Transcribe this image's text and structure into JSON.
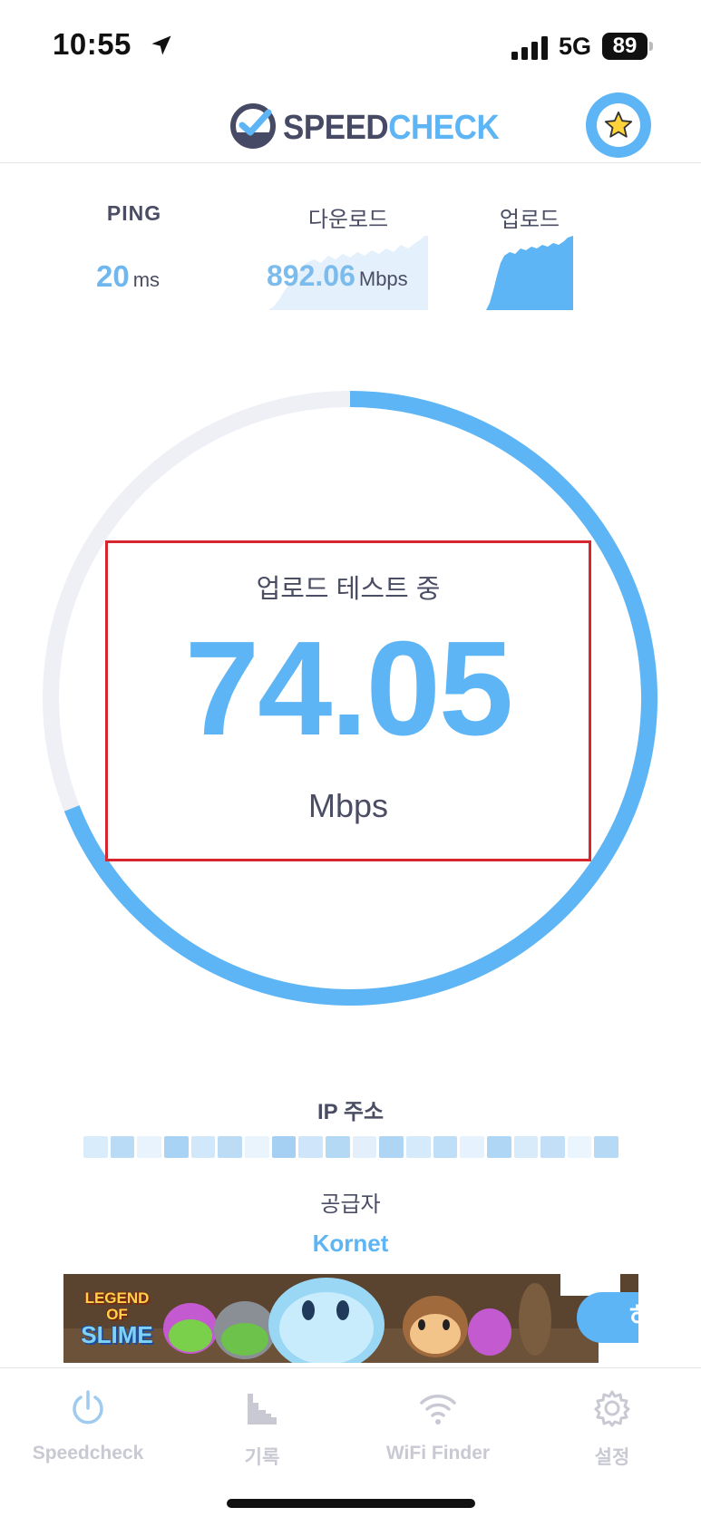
{
  "status_bar": {
    "time": "10:55",
    "network": "5G",
    "battery": "89"
  },
  "header": {
    "logo_part1": "SPEED",
    "logo_part2": "CHECK"
  },
  "metrics": {
    "ping": {
      "label": "PING",
      "value": "20",
      "unit": "ms"
    },
    "download": {
      "label": "다운로드",
      "value": "892.06",
      "unit": "Mbps"
    },
    "upload": {
      "label": "업로드"
    }
  },
  "gauge": {
    "status": "업로드 테스트 중",
    "value": "74.05",
    "unit": "Mbps",
    "progress": 0.69
  },
  "info": {
    "ip_label": "IP 주소",
    "provider_label": "공급자",
    "provider_value": "Kornet"
  },
  "ad": {
    "logo_line1": "LEGEND",
    "logo_line2": "OF",
    "logo_line3": "SLIME",
    "cta": "하다"
  },
  "tabs": [
    {
      "label": "Speedcheck",
      "icon": "power-icon"
    },
    {
      "label": "기록",
      "icon": "history-chart-icon"
    },
    {
      "label": "WiFi Finder",
      "icon": "wifi-icon"
    },
    {
      "label": "설정",
      "icon": "gear-icon"
    }
  ],
  "colors": {
    "accent": "#5db5f5",
    "text": "#4a4d63",
    "track": "#eef0f6",
    "highlight": "#d8262e"
  }
}
